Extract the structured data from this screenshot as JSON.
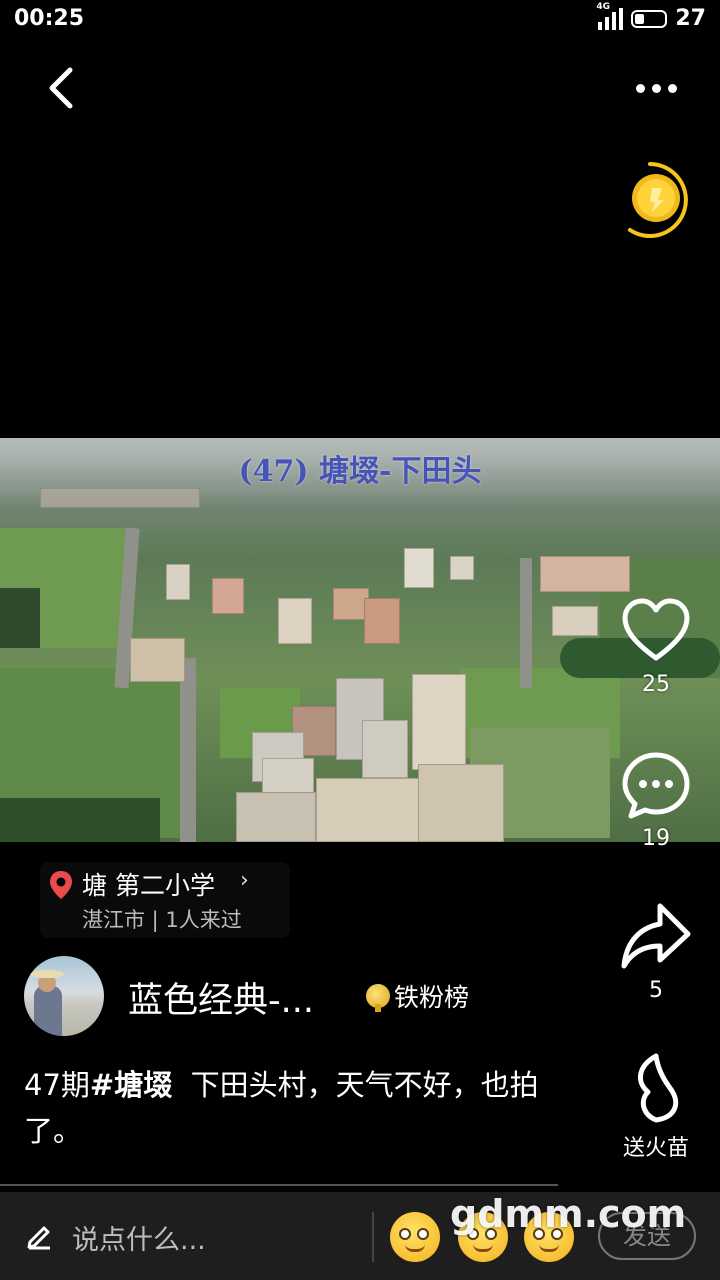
{
  "status_bar": {
    "time": "00:25",
    "network": "4G",
    "battery": "27"
  },
  "icons": {
    "back": "back-chevron-icon",
    "more": "more-dots-icon",
    "coin": "gold-coin-icon",
    "like": "heart-icon",
    "comment": "comment-bubble-icon",
    "share": "share-arrow-icon",
    "fire": "flame-icon",
    "location": "location-pin-icon",
    "badge": "medal-icon",
    "edit": "pen-icon"
  },
  "video": {
    "caption": "(47) 塘㙍-下田头"
  },
  "actions": {
    "likes": "25",
    "comments": "19",
    "shares": "5",
    "fire_label": "送火苗"
  },
  "location": {
    "name": "塘 第二小学",
    "chevron": "›",
    "subtitle": "湛江市 | 1人来过"
  },
  "author": {
    "name": "蓝色经典-...",
    "badge": "铁粉榜"
  },
  "description": {
    "issue": "47期",
    "hashtag": "#塘㙍",
    "text": "下田头村，天气不好，也拍了。"
  },
  "comment_bar": {
    "placeholder": "说点什么...",
    "send": "发送",
    "watermark": "gdmm.com"
  },
  "colors": {
    "background": "#000000",
    "caption": "#4654b8",
    "coin": "#f5c518",
    "pin": "#e94b4b"
  }
}
